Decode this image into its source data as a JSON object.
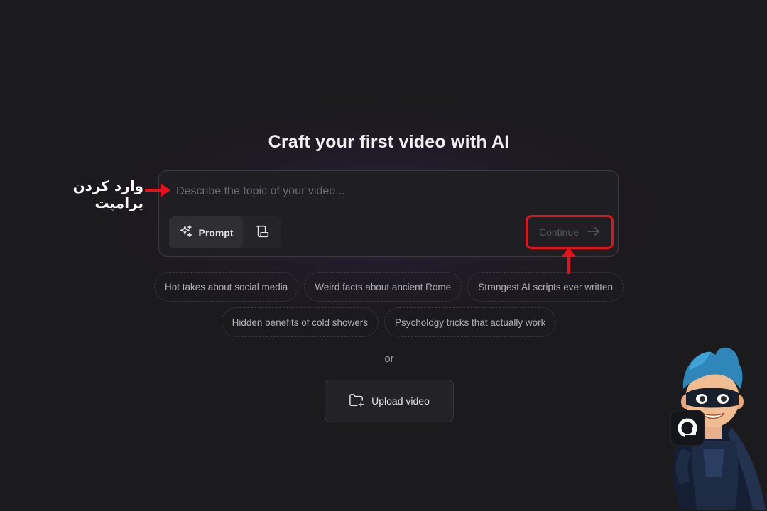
{
  "heading": "Craft your first video with AI",
  "composer": {
    "placeholder": "Describe the topic of your video...",
    "modes": [
      {
        "label": "Prompt",
        "icon": "sparkle-icon",
        "active": true
      },
      {
        "label": "",
        "icon": "script-icon",
        "active": false
      }
    ],
    "continue_label": "Continue"
  },
  "suggestions": {
    "row1": [
      "Hot takes about social media",
      "Weird facts about ancient Rome",
      "Strangest AI scripts ever written"
    ],
    "row2": [
      "Hidden benefits of cold showers",
      "Psychology tricks that actually work"
    ]
  },
  "divider_text": "or",
  "upload": {
    "label": "Upload video",
    "icon": "folder-plus-icon"
  },
  "annotation": {
    "label": "وارد کردن پرامپت",
    "color": "#e3121b"
  },
  "mascot": {
    "logo_letter": "a"
  }
}
